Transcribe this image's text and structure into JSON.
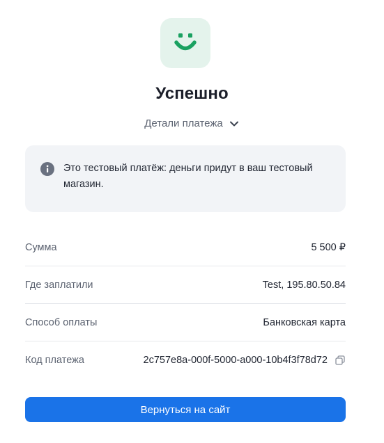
{
  "logo": {
    "icon": "smiley-icon",
    "bg_color": "#e4f3ec",
    "fg_color": "#1aa161"
  },
  "status": {
    "title": "Успешно"
  },
  "details": {
    "toggle_label": "Детали платежа",
    "icon": "chevron-down-icon"
  },
  "notice": {
    "icon": "info-icon",
    "text": "Это тестовый платёж: деньги придут в ваш тестовый магазин."
  },
  "payment": {
    "rows": [
      {
        "label": "Сумма",
        "value": "5 500 ₽"
      },
      {
        "label": "Где заплатили",
        "value": "Test, 195.80.50.84"
      },
      {
        "label": "Способ оплаты",
        "value": "Банковская карта"
      },
      {
        "label": "Код платежа",
        "value": "2c757e8a-000f-5000-a000-10b4f3f78d72",
        "action_icon": "copy-icon"
      }
    ]
  },
  "actions": {
    "return_label": "Вернуться на сайт",
    "accent_color": "#1a73e8"
  }
}
